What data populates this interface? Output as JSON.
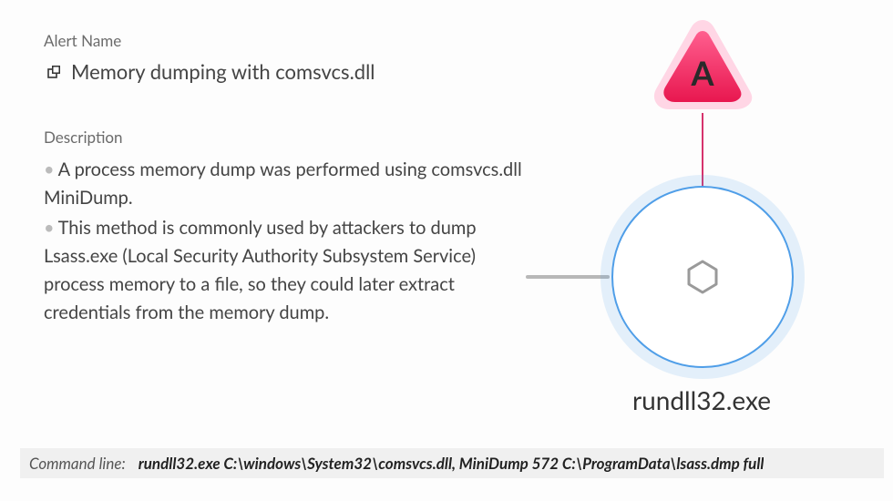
{
  "alert": {
    "name_label": "Alert Name",
    "name_value": "Memory dumping with comsvcs.dll",
    "desc_label": "Description",
    "desc_items": [
      "A process memory dump was performed using comsvcs.dll MiniDump.",
      "This method is commonly used by attackers to dump Lsass.exe (Local Security Authority Subsystem Service) process memory to a file, so they could later extract credentials from the memory dump."
    ]
  },
  "graph": {
    "alert_badge_letter": "A",
    "node_label": "rundll32.exe"
  },
  "command_line": {
    "label": "Command line:",
    "value": "rundll32.exe C:\\windows\\System32\\comsvcs.dll, MiniDump 572 C:\\ProgramData\\lsass.dmp full"
  },
  "colors": {
    "triangle_top": "#ff5f8f",
    "triangle_bottom": "#e8174f",
    "triangle_halo": "#ffd6e5",
    "node_border": "#4f9ee8"
  }
}
